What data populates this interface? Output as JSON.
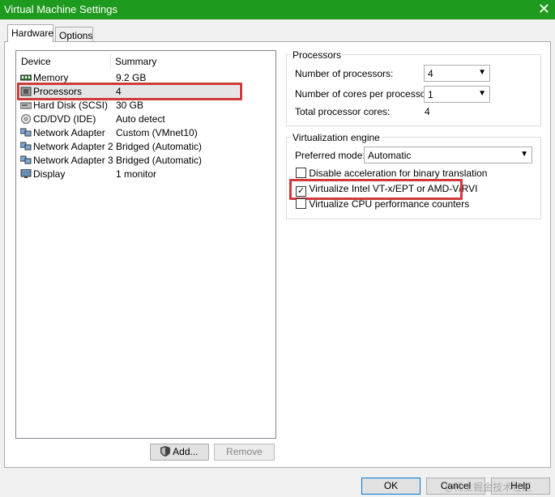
{
  "window": {
    "title": "Virtual Machine Settings",
    "close_symbol": "✕"
  },
  "tabs": [
    {
      "label": "Hardware",
      "active": true
    },
    {
      "label": "Options",
      "active": false
    }
  ],
  "device_list": {
    "headers": {
      "device": "Device",
      "summary": "Summary"
    },
    "items": [
      {
        "device": "Memory",
        "summary": "9.2 GB",
        "icon": "memory-icon"
      },
      {
        "device": "Processors",
        "summary": "4",
        "icon": "processor-icon",
        "selected": true
      },
      {
        "device": "Hard Disk (SCSI)",
        "summary": "30 GB",
        "icon": "hard-disk-icon"
      },
      {
        "device": "CD/DVD (IDE)",
        "summary": "Auto detect",
        "icon": "cd-dvd-icon"
      },
      {
        "device": "Network Adapter",
        "summary": "Custom (VMnet10)",
        "icon": "network-adapter-icon"
      },
      {
        "device": "Network Adapter 2",
        "summary": "Bridged (Automatic)",
        "icon": "network-adapter-icon"
      },
      {
        "device": "Network Adapter 3",
        "summary": "Bridged (Automatic)",
        "icon": "network-adapter-icon"
      },
      {
        "device": "Display",
        "summary": "1 monitor",
        "icon": "display-icon"
      }
    ],
    "add_label": "Add...",
    "remove_label": "Remove"
  },
  "processors": {
    "title": "Processors",
    "num_processors_label": "Number of processors:",
    "num_processors_value": "4",
    "cores_label": "Number of cores per processor:",
    "cores_value": "1",
    "total_label": "Total processor cores:",
    "total_value": "4"
  },
  "virtualization": {
    "title": "Virtualization engine",
    "mode_label": "Preferred mode:",
    "mode_value": "Automatic",
    "options": [
      {
        "label": "Disable acceleration for binary translation",
        "checked": false
      },
      {
        "label": "Virtualize Intel VT-x/EPT or AMD-V/RVI",
        "checked": true
      },
      {
        "label": "Virtualize CPU performance counters",
        "checked": false
      }
    ]
  },
  "footer": {
    "ok": "OK",
    "cancel": "Cancel",
    "help": "Help"
  },
  "watermark": "@稀土掘金技术社区",
  "colors": {
    "titlebar": "#1e9b1e",
    "highlight": "#d03a3a"
  }
}
